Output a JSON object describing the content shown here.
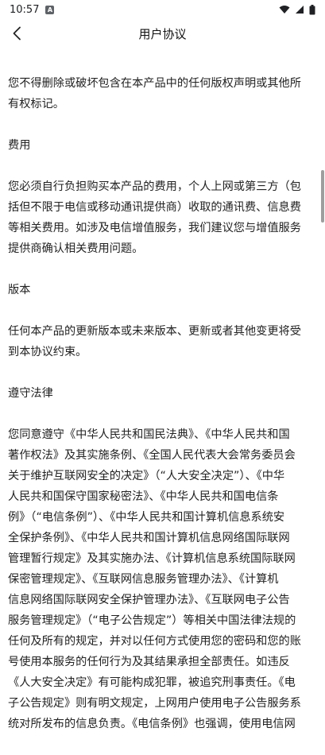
{
  "status_bar": {
    "time": "10:57",
    "notification_icon": "a-badge-icon",
    "wifi_icon": "wifi-icon",
    "signal_icon": "signal-icon",
    "battery_icon": "battery-icon"
  },
  "header": {
    "title": "用户协议",
    "back_icon": "chevron-left-icon"
  },
  "content": {
    "paragraphs": [
      "您不得删除或破坏包含在本产品中的任何版权声明或其他所\n有权标记。",
      "费用",
      "您必须自行负担购买本产品的费用，个人上网或第三方（包\n括但不限于电信或移动通讯提供商）收取的通讯费、信息费\n等相关费用。如涉及电信增值服务，我们建议您与增值服务\n提供商确认相关费用问题。",
      "版本",
      "任何本产品的更新版本或未来版本、更新或者其他变更将受\n到本协议约束。",
      "遵守法律",
      "您同意遵守《中华人民共和国民法典》、《中华人民共和国\n著作权法》及其实施条例、《全国人民代表大会常务委员会\n关于维护互联网安全的决定》（“人大安全决定”）、《中华\n人民共和国保守国家秘密法》、《中华人民共和国电信条\n例》（“电信条例”）、《中华人民共和国计算机信息系统安\n全保护条例》、《中华人民共和国计算机信息网络国际联网\n管理暂行规定》及其实施办法、《计算机信息系统国际联网\n保密管理规定》、《互联网信息服务管理办法》、《计算机\n信息网络国际联网安全保护管理办法》、《互联网电子公告\n服务管理规定》（“电子公告规定”）等相关中国法律法规的\n任何及所有的规定，并对以任何方式使用您的密码和您的账\n号使用本服务的任何行为及其结果承担全部责任。如违反\n《人大安全决定》有可能构成犯罪，被追究刑事责任。《电\n子公告规定》则有明文规定，上网用户使用电子公告服务系\n统对所发布的信息负责。《电信条例》也强调，使用电信网"
    ]
  }
}
